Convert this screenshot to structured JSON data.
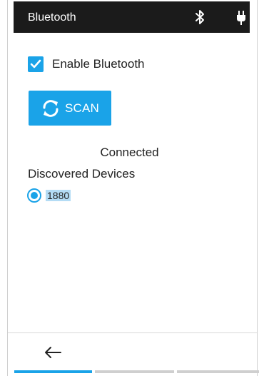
{
  "header": {
    "title": "Bluetooth",
    "icons": [
      "bluetooth-icon",
      "plug-icon"
    ]
  },
  "settings": {
    "enable_label": "Enable Bluetooth",
    "enable_checked": true
  },
  "scan": {
    "label": "SCAN",
    "icon": "refresh-icon"
  },
  "status": {
    "text": "Connected"
  },
  "devices": {
    "heading": "Discovered Devices",
    "items": [
      {
        "name": "1880",
        "selected": true
      }
    ]
  },
  "navigation": {
    "back_icon": "arrow-left-icon",
    "tabs": 3,
    "active_tab": 1
  },
  "colors": {
    "accent": "#1aa3e8",
    "header": "#1b1b1b",
    "highlight": "#b4dcf5"
  }
}
